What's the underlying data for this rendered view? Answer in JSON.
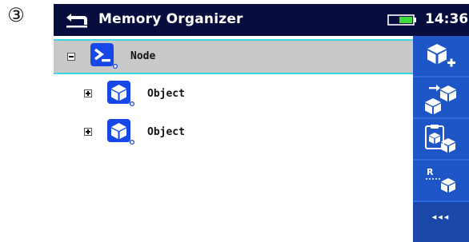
{
  "step_marker": "③",
  "titlebar": {
    "title": "Memory Organizer",
    "time": "14:36"
  },
  "tree": {
    "root": {
      "label": "Node",
      "expanded": true,
      "selected": true,
      "icon": "node-terminal-icon"
    },
    "children": [
      {
        "label": "Object",
        "expanded": false,
        "icon": "object-cube-icon"
      },
      {
        "label": "Object",
        "expanded": false,
        "icon": "object-cube-icon"
      }
    ]
  },
  "sidebar": {
    "buttons": [
      {
        "icon": "add-object-icon"
      },
      {
        "icon": "move-object-icon"
      },
      {
        "icon": "copy-object-icon"
      },
      {
        "icon": "rename-object-icon"
      }
    ],
    "more_label": "◂◂◂"
  },
  "colors": {
    "titlebar_bg": "#070d3d",
    "sidebar_bg": "#1e56c8",
    "selection_bg": "#c8c8c8",
    "selection_border": "#3fd4e6",
    "icon_blue": "#1747e6"
  }
}
